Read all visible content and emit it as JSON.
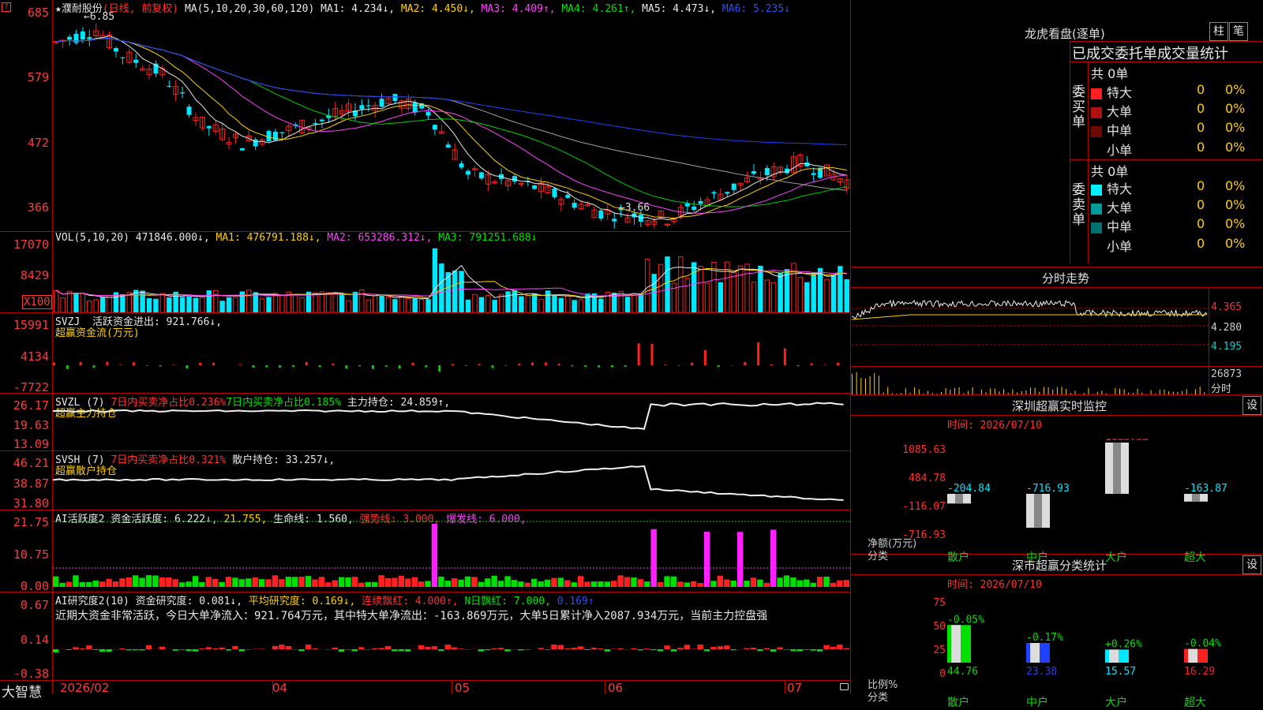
{
  "stock": {
    "name": "★濮耐股份",
    "mode": "(日线, 前复权)",
    "ma_prefix": "MA(5,10,20,30,60,120)",
    "ma1": "MA1: 4.234↓,",
    "ma2": "MA2: 4.450↓,",
    "ma3": "MA3: 4.409↑,",
    "ma4": "MA4: 4.261↑,",
    "ma5": "MA5: 4.473↓,",
    "ma6": "MA6: 5.235↓",
    "high_mark": "6.85",
    "low_mark": "3.66"
  },
  "price_axis": [
    "685",
    "579",
    "472",
    "366"
  ],
  "volume": {
    "prefix": "VOL(5,10,20)",
    "value": "471846.000↓,",
    "ma1": "MA1: 476791.188↓,",
    "ma2": "MA2: 653286.312↓,",
    "ma3": "MA3: 791251.688↓",
    "axis": [
      "17070",
      "8429",
      "X100"
    ]
  },
  "svzj": {
    "prefix": "SVZJ",
    "text": "活跃资金进出: 921.766↓,",
    "subtitle": "超赢资金流(万元)",
    "axis": [
      "15991",
      "4134",
      "-7722"
    ]
  },
  "svzl": {
    "prefix": "SVZL (7)",
    "t1": "7日内买卖净占比0.236%",
    "t2": "7日内买卖净占比0.185%",
    "t3": "主力持仓: 24.859↑,",
    "subtitle": "超赢主力持仓",
    "axis": [
      "26.17",
      "19.63",
      "13.09"
    ]
  },
  "svsh": {
    "prefix": "SVSH (7)",
    "t1": "7日内买卖净占比0.321%",
    "t2": "散户持仓: 33.257↓,",
    "subtitle": "超赢散户持仓",
    "axis": [
      "46.21",
      "38.87",
      "31.80"
    ]
  },
  "ai1": {
    "prefix": "AI活跃度2",
    "t1": "资金活跃度: 6.222↓,",
    "t2": "21.755,",
    "t3": "生命线: 1.560,",
    "t4": "强势线: 3.000,",
    "t5": "爆发线: 6.000,",
    "axis": [
      "21.75",
      "10.75",
      "0.00"
    ]
  },
  "ai2": {
    "prefix": "AI研究度2(10)",
    "t1": "资金研究度: 0.081↓,",
    "t2": "平均研究度: 0.169↓,",
    "t3": "连续飘红: 4.000↑,",
    "t4": "N日飘红: 7.000,",
    "t5": "0.169↑",
    "comment": "近期大资金非常活跃，今日大单净流入：921.764万元，其中特大单净流出：-163.869万元，大单5日累计净入2087.934万元，当前主力控盘强",
    "axis": [
      "0.67",
      "0.14",
      "-0.38"
    ]
  },
  "xaxis": {
    "brand": "大智慧",
    "labels": [
      "2026/02",
      "04",
      "05",
      "06",
      "07"
    ]
  },
  "right": {
    "dragon_title": "龙虎看盘(逐单)",
    "btn_column": "柱",
    "btn_stroke": "笔",
    "header": "已成交委托单成交量统计",
    "buy_label": "委买单",
    "sell_label": "委卖单",
    "buy_total": "共 0单",
    "sell_total": "共 0单",
    "buy_rows": [
      {
        "label": "特大",
        "count": "0",
        "pct": "0%"
      },
      {
        "label": "大单",
        "count": "0",
        "pct": "0%"
      },
      {
        "label": "中单",
        "count": "0",
        "pct": "0%"
      },
      {
        "label": "小单",
        "count": "0",
        "pct": "0%"
      }
    ],
    "sell_rows": [
      {
        "label": "特大",
        "count": "0",
        "pct": "0%"
      },
      {
        "label": "大单",
        "count": "0",
        "pct": "0%"
      },
      {
        "label": "中单",
        "count": "0",
        "pct": "0%"
      },
      {
        "label": "小单",
        "count": "0",
        "pct": "0%"
      }
    ],
    "intraday_title": "分时走势",
    "intraday_axis": [
      "4.365",
      "4.280",
      "4.195",
      "26873",
      "分时"
    ],
    "monitor_title": "深圳超赢实时监控",
    "monitor_btn": "设",
    "monitor_time": "时间: 2026/07/10",
    "monitor_axis": [
      "1085.63",
      "484.78",
      "-116.07",
      "-716.93"
    ],
    "monitor_ylabel": "净额(万元)",
    "monitor_xlabel": "分类",
    "monitor_cats": [
      "散户",
      "中户",
      "大户",
      "超大"
    ],
    "monitor_values": [
      "-204.84",
      "-716.93",
      "1085.63",
      "-163.87"
    ],
    "class_title": "深市超赢分类统计",
    "class_btn": "设",
    "class_time": "时间: 2026/07/10",
    "class_axis": [
      "75",
      "50",
      "25",
      "0"
    ],
    "class_ylabel": "比例%",
    "class_xlabel": "分类",
    "class_cats": [
      "散户",
      "中户",
      "大户",
      "超大"
    ],
    "class_pcts": [
      "-0.05%",
      "-0.17%",
      "+0.26%",
      "-0.04%"
    ],
    "class_values": [
      "44.76",
      "23.38",
      "15.57",
      "16.29"
    ]
  },
  "colors": {
    "grid": "#b00000",
    "up": "#ff2020",
    "down": "#00e8ff",
    "ma1": "#e8e8e8",
    "ma2": "#ffd000",
    "ma3": "#ff40ff",
    "ma4": "#00d000",
    "ma5": "#a0a0a0",
    "ma6": "#2040ff"
  }
}
